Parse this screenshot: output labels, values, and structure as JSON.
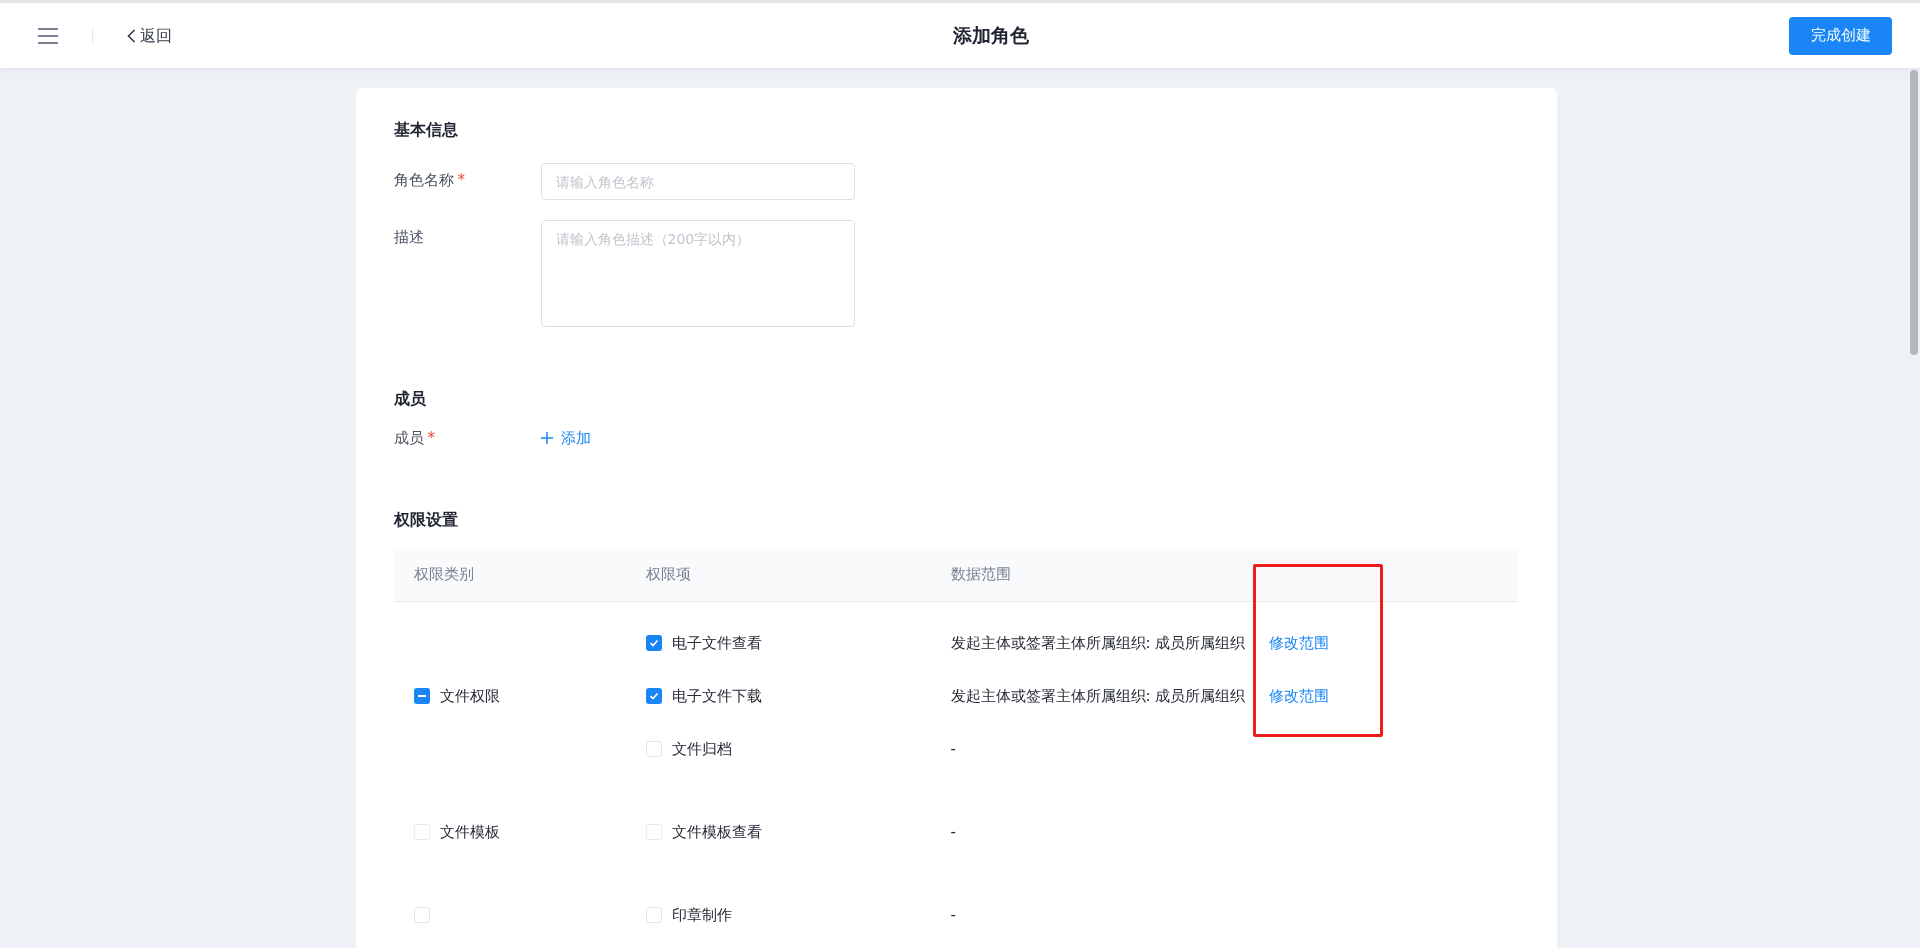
{
  "header": {
    "back": "返回",
    "title": "添加角色",
    "submit": "完成创建"
  },
  "basic": {
    "title": "基本信息",
    "fields": [
      {
        "kind": "input",
        "label": "角色名称",
        "required_mark": "*",
        "placeholder": "请输入角色名称"
      },
      {
        "kind": "textarea",
        "label": "描述",
        "placeholder": "请输入角色描述（200字以内）"
      }
    ]
  },
  "members": {
    "title": "成员",
    "label": "成员",
    "required_mark": "*",
    "add": "添加"
  },
  "permissions": {
    "title": "权限设置",
    "columns": [
      "权限类别",
      "权限项",
      "数据范围"
    ],
    "groups": [
      {
        "label": "文件权限",
        "checked": false,
        "indeterminate": true,
        "items": [
          {
            "label": "电子文件查看",
            "checked": true,
            "scope": "发起主体或签署主体所属组织: 成员所属组织",
            "link": "修改范围"
          },
          {
            "label": "电子文件下载",
            "checked": true,
            "scope": "发起主体或签署主体所属组织: 成员所属组织",
            "link": "修改范围"
          },
          {
            "label": "文件归档",
            "checked": false,
            "scope": "-"
          }
        ]
      },
      {
        "label": "文件模板",
        "checked": false,
        "indeterminate": false,
        "items": [
          {
            "label": "文件模板查看",
            "checked": false,
            "scope": "-"
          }
        ]
      },
      {
        "checked": false,
        "indeterminate": false,
        "items": [
          {
            "label": "印章制作",
            "checked": false,
            "scope": "-"
          }
        ]
      }
    ]
  }
}
